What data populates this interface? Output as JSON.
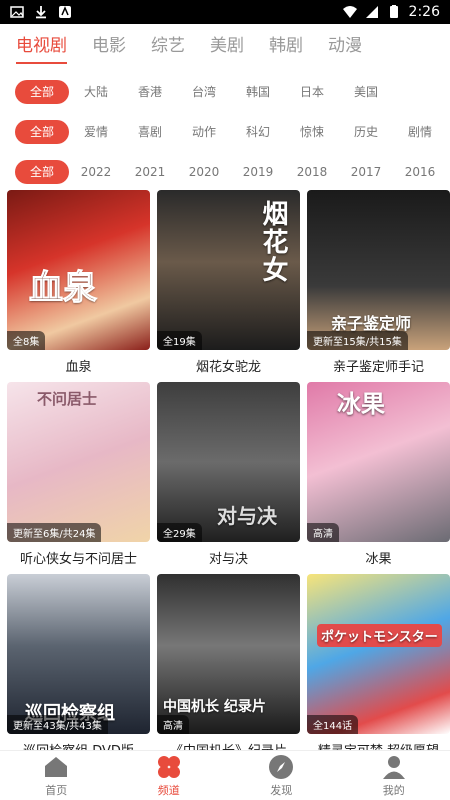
{
  "status_bar": {
    "time": "2:26"
  },
  "top_tabs": [
    "电视剧",
    "电影",
    "综艺",
    "美剧",
    "韩剧",
    "动漫"
  ],
  "filters": {
    "region": [
      "全部",
      "大陆",
      "香港",
      "台湾",
      "韩国",
      "日本",
      "美国"
    ],
    "genre": [
      "全部",
      "爱情",
      "喜剧",
      "动作",
      "科幻",
      "惊悚",
      "历史",
      "剧情"
    ],
    "year": [
      "全部",
      "2022",
      "2021",
      "2020",
      "2019",
      "2018",
      "2017",
      "2016"
    ]
  },
  "cards": [
    {
      "title": "血泉",
      "badge": "全8集",
      "poster_text": "血泉"
    },
    {
      "title": "烟花女驼龙",
      "badge": "全19集",
      "poster_text": "烟花女"
    },
    {
      "title": "亲子鉴定师手记",
      "badge": "更新至15集/共15集",
      "poster_text": "亲子鉴定师"
    },
    {
      "title": "听心侠女与不问居士",
      "badge": "更新至6集/共24集",
      "poster_text": "不问居士"
    },
    {
      "title": "对与决",
      "badge": "全29集",
      "poster_text": "对与决"
    },
    {
      "title": "冰果",
      "badge": "高清",
      "poster_text": "冰果"
    },
    {
      "title": "巡回检察组 DVD版",
      "badge": "更新至43集/共43集",
      "poster_text": "巡回检察组"
    },
    {
      "title": "《中国机长》纪录片",
      "badge": "高清",
      "poster_text": "中国机长 纪录片"
    },
    {
      "title": "精灵宝可梦 超级愿望",
      "badge": "全144话",
      "poster_text": "ポケットモンスター"
    }
  ],
  "bottom_nav": [
    "首页",
    "频道",
    "发现",
    "我的"
  ],
  "colors": {
    "accent": "#e84b3c"
  }
}
